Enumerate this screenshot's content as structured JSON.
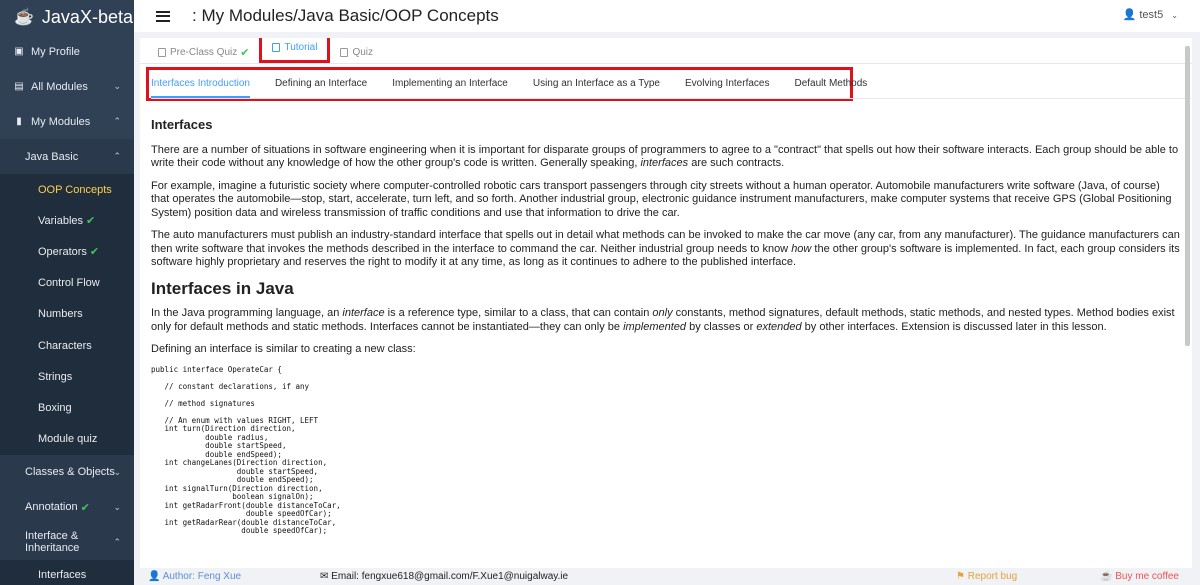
{
  "app": {
    "title": "JavaX-beta"
  },
  "sidebar": {
    "items": [
      {
        "label": "My Profile"
      },
      {
        "label": "All Modules"
      },
      {
        "label": "My Modules"
      },
      {
        "label": "Java Basic"
      },
      {
        "label": "OOP Concepts"
      },
      {
        "label": "Variables"
      },
      {
        "label": "Operators"
      },
      {
        "label": "Control Flow"
      },
      {
        "label": "Numbers"
      },
      {
        "label": "Characters"
      },
      {
        "label": "Strings"
      },
      {
        "label": "Boxing"
      },
      {
        "label": "Module quiz"
      },
      {
        "label": "Classes & Objects"
      },
      {
        "label": "Annotation"
      },
      {
        "label": "Interface & Inheritance"
      },
      {
        "label": "Interfaces"
      }
    ]
  },
  "header": {
    "breadcrumb": ": My Modules/Java Basic/OOP Concepts",
    "user": "test5"
  },
  "tabs": [
    {
      "label": "Pre-Class Quiz"
    },
    {
      "label": "Tutorial"
    },
    {
      "label": "Quiz"
    }
  ],
  "subtabs": [
    {
      "label": "Interfaces Introduction"
    },
    {
      "label": "Defining an Interface"
    },
    {
      "label": "Implementing an Interface"
    },
    {
      "label": "Using an Interface as a Type"
    },
    {
      "label": "Evolving Interfaces"
    },
    {
      "label": "Default Methods"
    }
  ],
  "content": {
    "h_interfaces": "Interfaces",
    "p1_a": "There are a number of situations in software engineering when it is important for disparate groups of programmers to agree to a \"contract\" that spells out how their software interacts. Each group should be able to write their code without any knowledge of how the other group's code is written. Generally speaking, ",
    "p1_em": "interfaces",
    "p1_b": " are such contracts.",
    "p2": "For example, imagine a futuristic society where computer-controlled robotic cars transport passengers through city streets without a human operator. Automobile manufacturers write software (Java, of course) that operates the automobile—stop, start, accelerate, turn left, and so forth. Another industrial group, electronic guidance instrument manufacturers, make computer systems that receive GPS (Global Positioning System) position data and wireless transmission of traffic conditions and use that information to drive the car.",
    "p3_a": "The auto manufacturers must publish an industry-standard interface that spells out in detail what methods can be invoked to make the car move (any car, from any manufacturer). The guidance manufacturers can then write software that invokes the methods described in the interface to command the car. Neither industrial group needs to know ",
    "p3_em": "how",
    "p3_b": " the other group's software is implemented. In fact, each group considers its software highly proprietary and reserves the right to modify it at any time, as long as it continues to adhere to the published interface.",
    "h_java": "Interfaces in Java",
    "p4_a": "In the Java programming language, an ",
    "p4_em1": "interface",
    "p4_b": " is a reference type, similar to a class, that can contain ",
    "p4_em2": "only",
    "p4_c": " constants, method signatures, default methods, static methods, and nested types. Method bodies exist only for default methods and static methods. Interfaces cannot be instantiated—they can only be ",
    "p4_em3": "implemented",
    "p4_d": " by classes or ",
    "p4_em4": "extended",
    "p4_e": " by other interfaces. Extension is discussed later in this lesson.",
    "p5": "Defining an interface is similar to creating a new class:",
    "code": "public interface OperateCar {\n\n   // constant declarations, if any\n\n   // method signatures\n\n   // An enum with values RIGHT, LEFT\n   int turn(Direction direction,\n            double radius,\n            double startSpeed,\n            double endSpeed);\n   int changeLanes(Direction direction,\n                   double startSpeed,\n                   double endSpeed);\n   int signalTurn(Direction direction,\n                  boolean signalOn);\n   int getRadarFront(double distanceToCar,\n                     double speedOfCar);\n   int getRadarRear(double distanceToCar,\n                    double speedOfCar);"
  },
  "footer": {
    "author": "Author: Feng Xue",
    "email": "Email: fengxue618@gmail.com/F.Xue1@nuigalway.ie",
    "report": "Report bug",
    "coffee": "Buy me coffee"
  },
  "colors": {
    "sidebar": "#304156",
    "accent": "#409eff",
    "active_menu": "#ffd04b",
    "highlight_box": "#e0101c"
  }
}
